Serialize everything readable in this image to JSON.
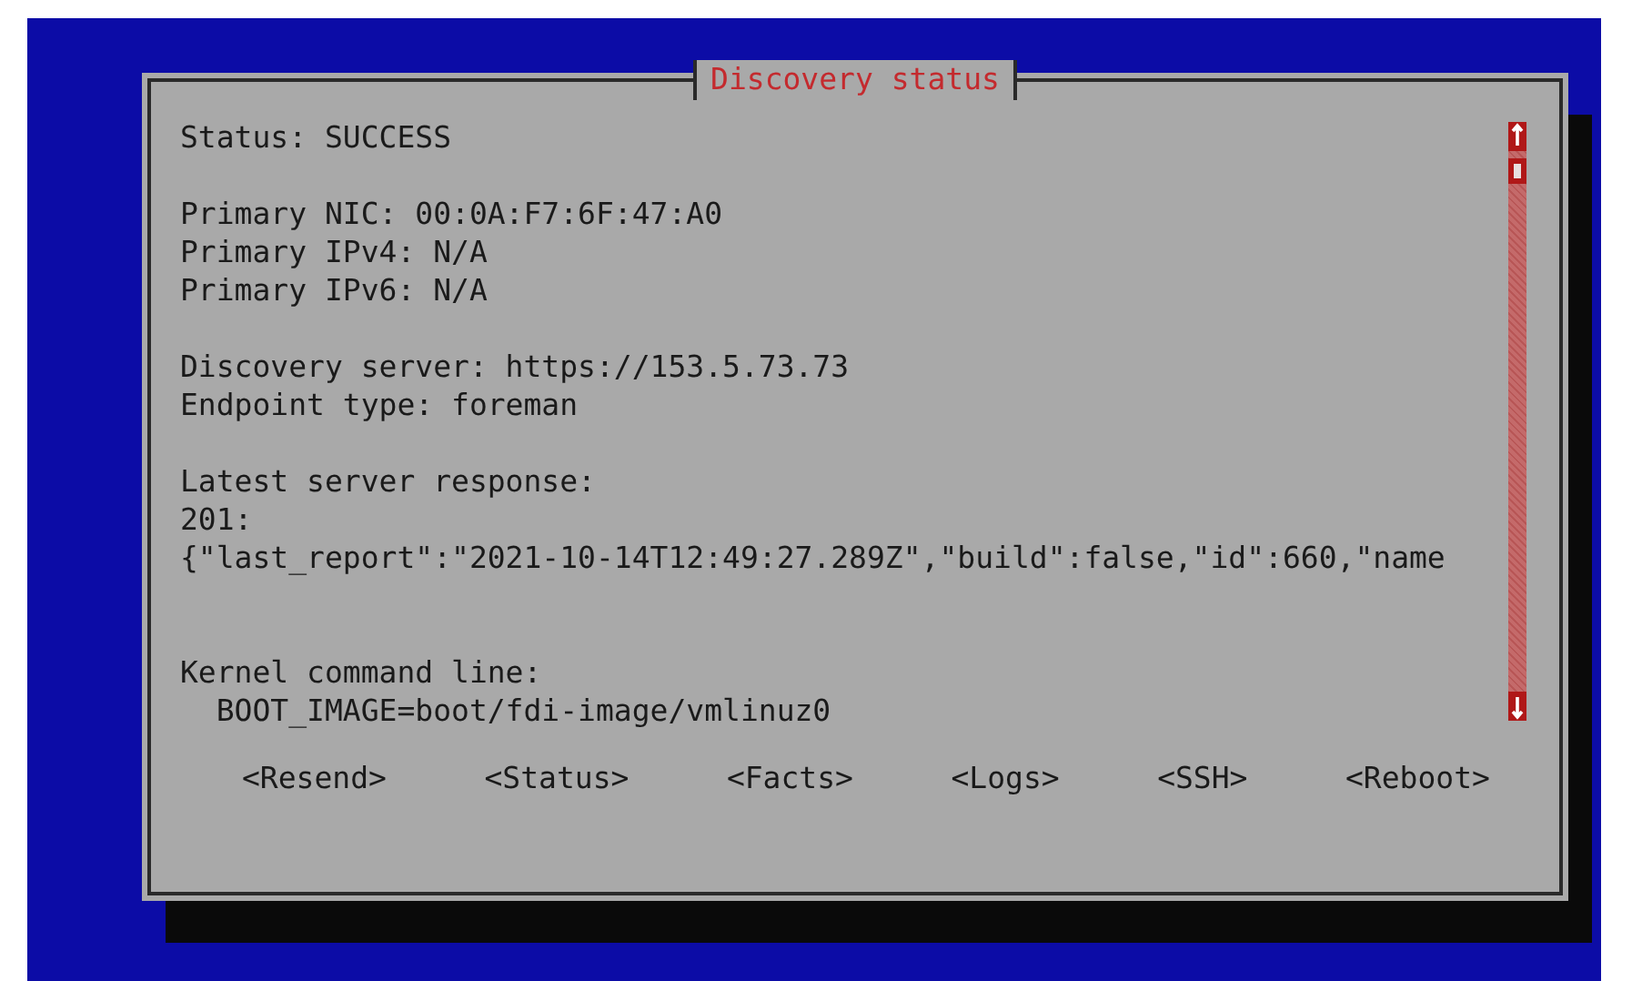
{
  "dialog": {
    "title": "Discovery status",
    "sections": [
      {
        "lines": [
          "Status: SUCCESS"
        ]
      },
      {
        "lines": [
          "Primary NIC: 00:0A:F7:6F:47:A0",
          "Primary IPv4: N/A",
          "Primary IPv6: N/A"
        ]
      },
      {
        "lines": [
          "Discovery server: https://153.5.73.73",
          "Endpoint type: foreman"
        ]
      },
      {
        "lines": [
          "Latest server response:",
          "201:",
          "{\"last_report\":\"2021-10-14T12:49:27.289Z\",\"build\":false,\"id\":660,\"name"
        ]
      },
      {
        "lines": [
          "Kernel command line:",
          "  BOOT_IMAGE=boot/fdi-image/vmlinuz0"
        ]
      }
    ],
    "buttons": [
      "<Resend>",
      "<Status>",
      "<Facts>",
      "<Logs>",
      "<SSH>",
      "<Reboot>"
    ]
  }
}
